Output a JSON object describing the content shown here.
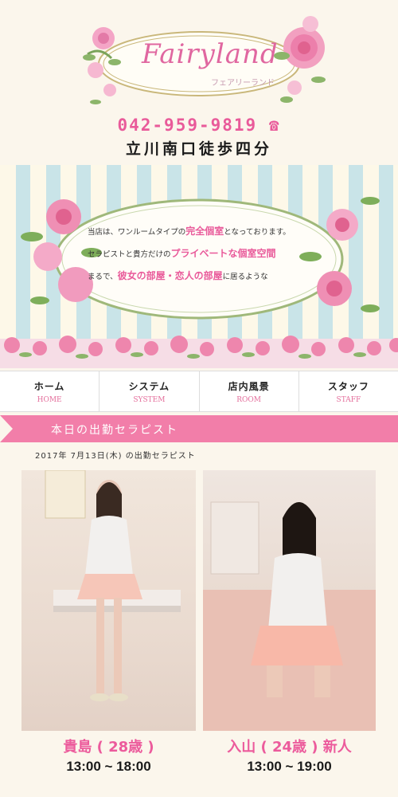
{
  "header": {
    "logo": "Fairyland",
    "logo_sub": "フェアリーランド",
    "phone": "042-959-9819",
    "access": "立川南口徒歩四分"
  },
  "banner": {
    "line1_pre": "当店は、ワンルームタイプの",
    "line1_em": "完全個室",
    "line1_post": "となっております。",
    "line2_pre": "セラピストと貴方だけの",
    "line2_em": "プライベートな個室空間",
    "line3_pre": "まるで、",
    "line3_em": "彼女の部屋・恋人の部屋",
    "line3_post": "に居るような"
  },
  "nav": [
    {
      "ja": "ホーム",
      "en": "HOME"
    },
    {
      "ja": "システム",
      "en": "SYSTEM"
    },
    {
      "ja": "店内風景",
      "en": "ROOM"
    },
    {
      "ja": "スタッフ",
      "en": "STAFF"
    }
  ],
  "section": {
    "title": "本日の出勤セラピスト",
    "date": "2017年 7月13日(木) の出勤セラピスト"
  },
  "therapists": [
    {
      "name": "貴島 ( 28歳 )",
      "time": "13:00 ~ 18:00"
    },
    {
      "name": "入山 ( 24歳 ) 新人",
      "time": "13:00 ~ 19:00"
    }
  ],
  "colors": {
    "accent": "#f27ea9",
    "name": "#ec5b9c",
    "logo": "#e067a0"
  }
}
